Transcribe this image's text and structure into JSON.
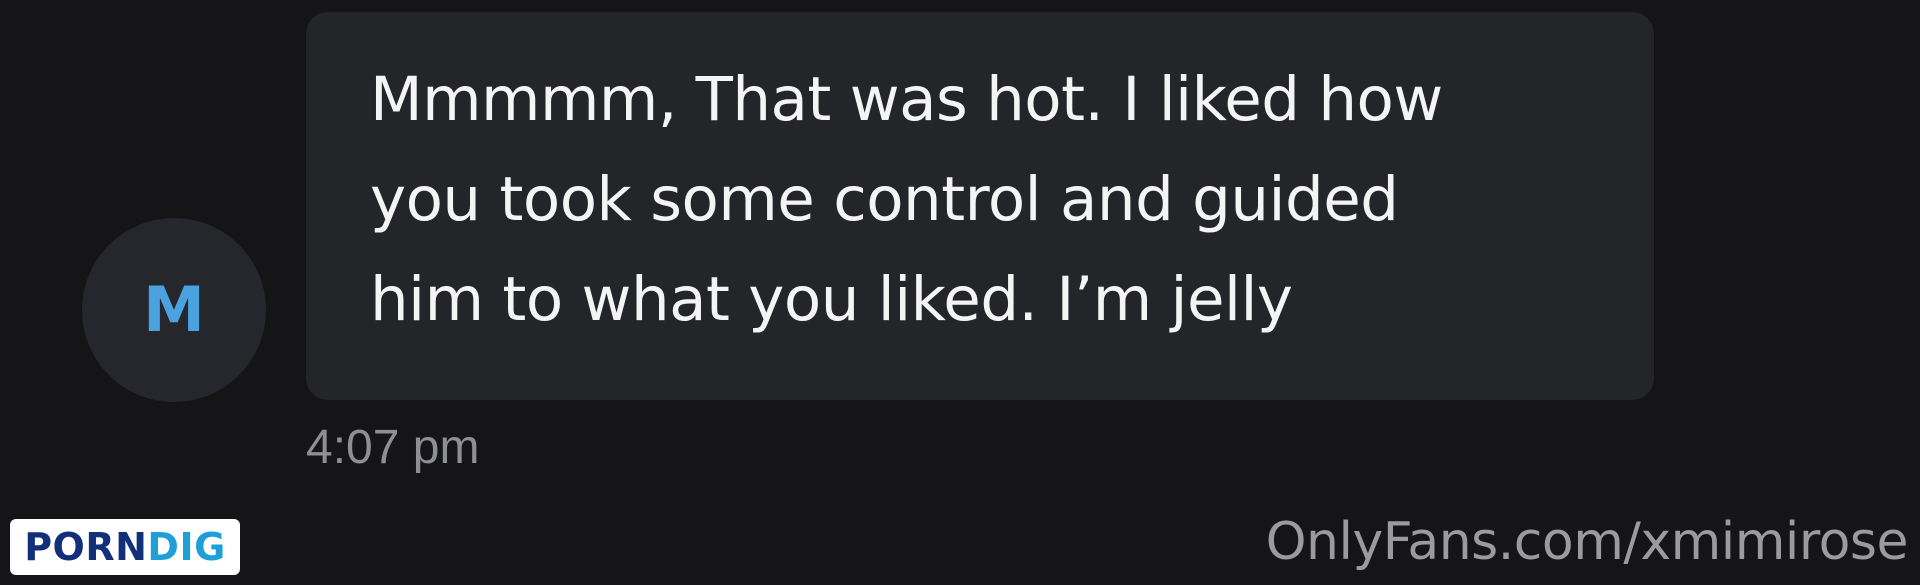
{
  "message": {
    "sender_initial": "M",
    "text": "Mmmmm, That was hot. I liked how\nyou took some control and guided\nhim to what you liked. I’m jelly",
    "timestamp": "4:07 pm"
  },
  "overlay": {
    "brand_part_a": "PORN",
    "brand_part_b": "DIG",
    "watermark": "OnlyFans.com/xmimirose"
  },
  "colors": {
    "background": "#151518",
    "bubble": "#242529",
    "avatar_bg": "#26272c",
    "avatar_initial": "#4aa3de",
    "message_text": "#f4f4f4",
    "timestamp": "#8e8f95"
  }
}
